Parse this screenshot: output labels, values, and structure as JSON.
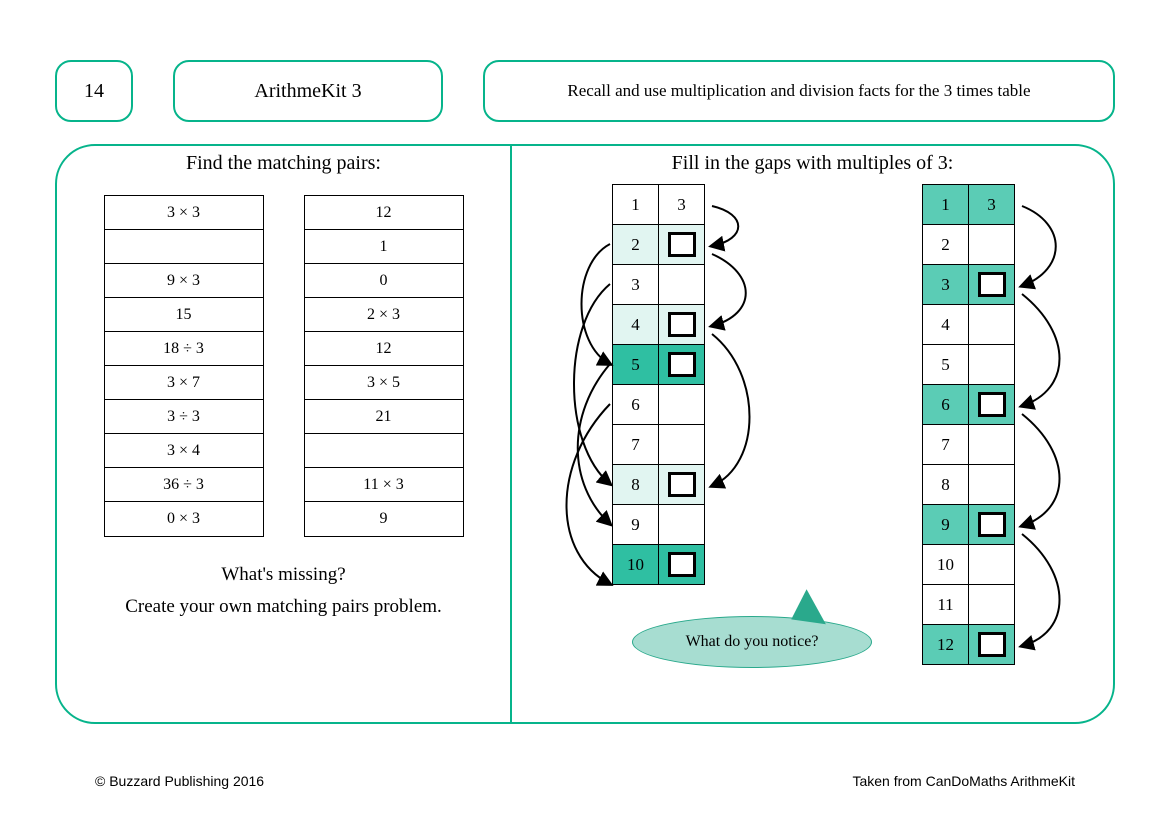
{
  "header": {
    "number": "14",
    "title": "ArithmeKit 3",
    "description": "Recall and use multiplication and division facts for the 3 times table"
  },
  "left": {
    "title": "Find the matching pairs:",
    "colA": [
      "3 × 3",
      "",
      "9 × 3",
      "15",
      "18 ÷ 3",
      "3 × 7",
      "3 ÷ 3",
      "3 × 4",
      "36 ÷ 3",
      "0 × 3"
    ],
    "colB": [
      "12",
      "1",
      "0",
      "2 × 3",
      "12",
      "3 × 5",
      "21",
      "",
      "11 × 3",
      "9"
    ],
    "q1": "What's missing?",
    "q2": "Create your own matching pairs problem."
  },
  "right": {
    "title": "Fill in the gaps with multiples of 3:",
    "table1": [
      {
        "n": "1",
        "shade": "",
        "val": "3",
        "vshade": ""
      },
      {
        "n": "2",
        "shade": "shade1",
        "val": "[box]",
        "vshade": "shade1"
      },
      {
        "n": "3",
        "shade": "",
        "val": "",
        "vshade": ""
      },
      {
        "n": "4",
        "shade": "shade1",
        "val": "[box]",
        "vshade": "shade1"
      },
      {
        "n": "5",
        "shade": "shade3",
        "val": "[box]",
        "vshade": "shade3"
      },
      {
        "n": "6",
        "shade": "",
        "val": "",
        "vshade": ""
      },
      {
        "n": "7",
        "shade": "",
        "val": "",
        "vshade": ""
      },
      {
        "n": "8",
        "shade": "shade1",
        "val": "[box]",
        "vshade": "shade1"
      },
      {
        "n": "9",
        "shade": "",
        "val": "",
        "vshade": ""
      },
      {
        "n": "10",
        "shade": "shade3",
        "val": "[box]",
        "vshade": "shade3"
      }
    ],
    "table2": [
      {
        "n": "1",
        "shade": "shade4",
        "val": "3",
        "vshade": "shade4"
      },
      {
        "n": "2",
        "shade": "",
        "val": "",
        "vshade": ""
      },
      {
        "n": "3",
        "shade": "shade4",
        "val": "[box]",
        "vshade": "shade4"
      },
      {
        "n": "4",
        "shade": "",
        "val": "",
        "vshade": ""
      },
      {
        "n": "5",
        "shade": "",
        "val": "",
        "vshade": ""
      },
      {
        "n": "6",
        "shade": "shade4",
        "val": "[box]",
        "vshade": "shade4"
      },
      {
        "n": "7",
        "shade": "",
        "val": "",
        "vshade": ""
      },
      {
        "n": "8",
        "shade": "",
        "val": "",
        "vshade": ""
      },
      {
        "n": "9",
        "shade": "shade4",
        "val": "[box]",
        "vshade": "shade4"
      },
      {
        "n": "10",
        "shade": "",
        "val": "",
        "vshade": ""
      },
      {
        "n": "11",
        "shade": "",
        "val": "",
        "vshade": ""
      },
      {
        "n": "12",
        "shade": "shade4",
        "val": "[box]",
        "vshade": "shade4"
      }
    ],
    "speech": "What do you notice?"
  },
  "footer": {
    "left": "© Buzzard Publishing 2016",
    "right": "Taken from CanDoMaths ArithmeKit"
  }
}
